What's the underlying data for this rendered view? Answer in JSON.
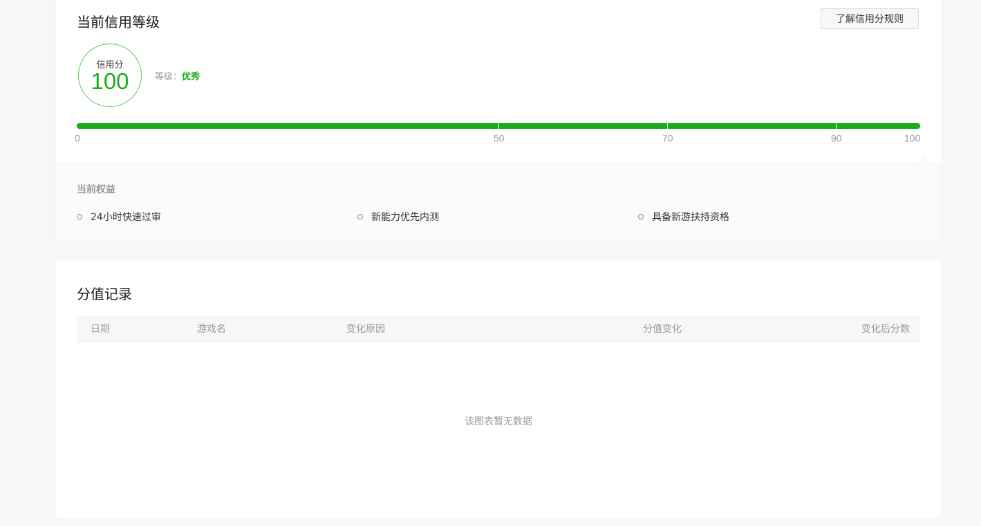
{
  "credit": {
    "title": "当前信用等级",
    "rules_button": "了解信用分规则",
    "score_label": "信用分",
    "score": "100",
    "level_label": "等级：",
    "level_value": "优秀",
    "progress_percent": 100,
    "ticks": [
      "0",
      "50",
      "70",
      "90",
      "100"
    ]
  },
  "benefits": {
    "title": "当前权益",
    "items": [
      "24小时快速过审",
      "新能力优先内测",
      "具备新游扶持资格"
    ]
  },
  "records": {
    "title": "分值记录",
    "columns": [
      "日期",
      "游戏名",
      "变化原因",
      "分值变化",
      "变化后分数"
    ],
    "empty_text": "该图表暂无数据"
  },
  "colors": {
    "accent": "#1aad19",
    "page_bg": "#f6f7f9"
  }
}
